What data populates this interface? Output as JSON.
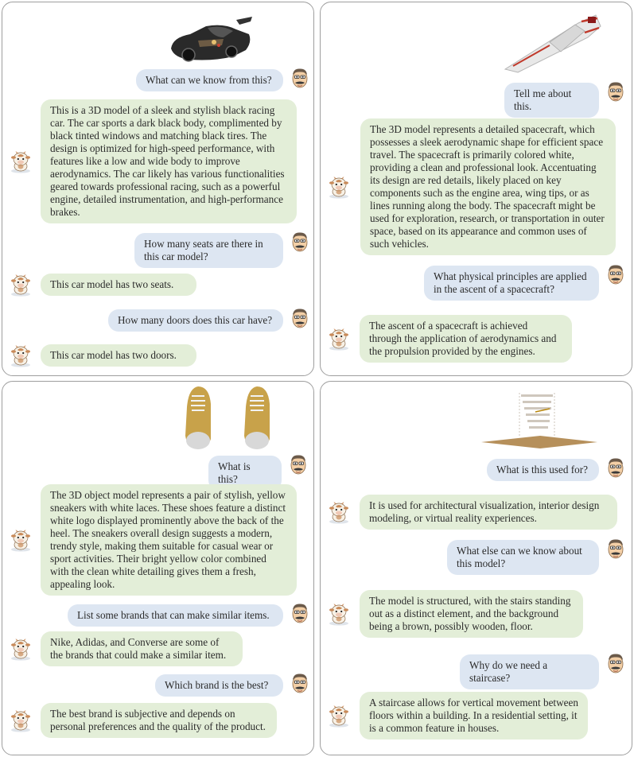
{
  "panels": [
    {
      "object": "racing-car-model",
      "messages": [
        {
          "role": "user",
          "text": "What can we know from this?"
        },
        {
          "role": "assistant",
          "text": "This is a 3D model of a sleek and stylish black racing car. The car sports a dark black body, complimented by black tinted windows and matching black tires. The design is optimized for high-speed performance, with features like a low and wide body to improve aerodynamics. The car likely has various functionalities geared towards professional racing, such as a powerful engine, detailed instrumentation, and high-performance brakes."
        },
        {
          "role": "user",
          "text": "How many seats are there in this car model?"
        },
        {
          "role": "assistant",
          "text": "This car model has two seats."
        },
        {
          "role": "user",
          "text": "How many doors does this car have?"
        },
        {
          "role": "assistant",
          "text": "This car model has two doors."
        }
      ]
    },
    {
      "object": "spacecraft-model",
      "messages": [
        {
          "role": "user",
          "text": "Tell me about this."
        },
        {
          "role": "assistant",
          "text": "The 3D model represents a detailed spacecraft, which possesses a sleek aerodynamic shape for efficient space travel. The spacecraft is primarily colored white, providing a clean and professional look. Accentuating its design are red details, likely placed on key components such as the engine area, wing tips, or as lines running along the body. The spacecraft might be used for exploration, research, or transportation in outer space, based on its appearance and common uses of such vehicles."
        },
        {
          "role": "user",
          "text": "What physical principles are applied in the ascent of a spacecraft?"
        },
        {
          "role": "assistant",
          "text": "The ascent of a spacecraft is achieved through the application of aerodynamics and the propulsion provided by the engines."
        }
      ]
    },
    {
      "object": "sneakers-model",
      "messages": [
        {
          "role": "user",
          "text": "What is this?"
        },
        {
          "role": "assistant",
          "text": "The 3D object model represents a pair of stylish, yellow sneakers with white laces. These shoes feature a distinct white logo displayed prominently above the back of the heel. The sneakers overall design suggests a modern, trendy style, making them suitable for casual wear or sport activities. Their bright yellow color combined with the clean white detailing gives them a fresh, appealing look."
        },
        {
          "role": "user",
          "text": "List some brands that can make similar items."
        },
        {
          "role": "assistant",
          "text": "Nike, Adidas, and Converse are some of the brands that could make a similar item."
        },
        {
          "role": "user",
          "text": "Which brand is the best?"
        },
        {
          "role": "assistant",
          "text": "The best brand is subjective and depends on personal preferences and the quality of the product."
        }
      ]
    },
    {
      "object": "staircase-model",
      "messages": [
        {
          "role": "user",
          "text": "What is this used for?"
        },
        {
          "role": "assistant",
          "text": "It is used for architectural visualization, interior design modeling, or virtual reality experiences."
        },
        {
          "role": "user",
          "text": "What else can we know about this model?"
        },
        {
          "role": "assistant",
          "text": "The model is structured, with the stairs standing out as a distinct element, and the background being a brown, possibly wooden, floor."
        },
        {
          "role": "user",
          "text": "Why do we need a staircase?"
        },
        {
          "role": "assistant",
          "text": "A staircase allows for vertical movement between floors within a building. In a residential setting, it is a common feature in houses."
        }
      ]
    }
  ],
  "colors": {
    "user_bubble": "#dde6f2",
    "assistant_bubble": "#e3eed8",
    "panel_border": "#9e9e9e",
    "text": "#2b2b2b"
  },
  "icons": {
    "user_avatar": "man-face-icon",
    "assistant_avatar": "cow-mascot-icon"
  }
}
